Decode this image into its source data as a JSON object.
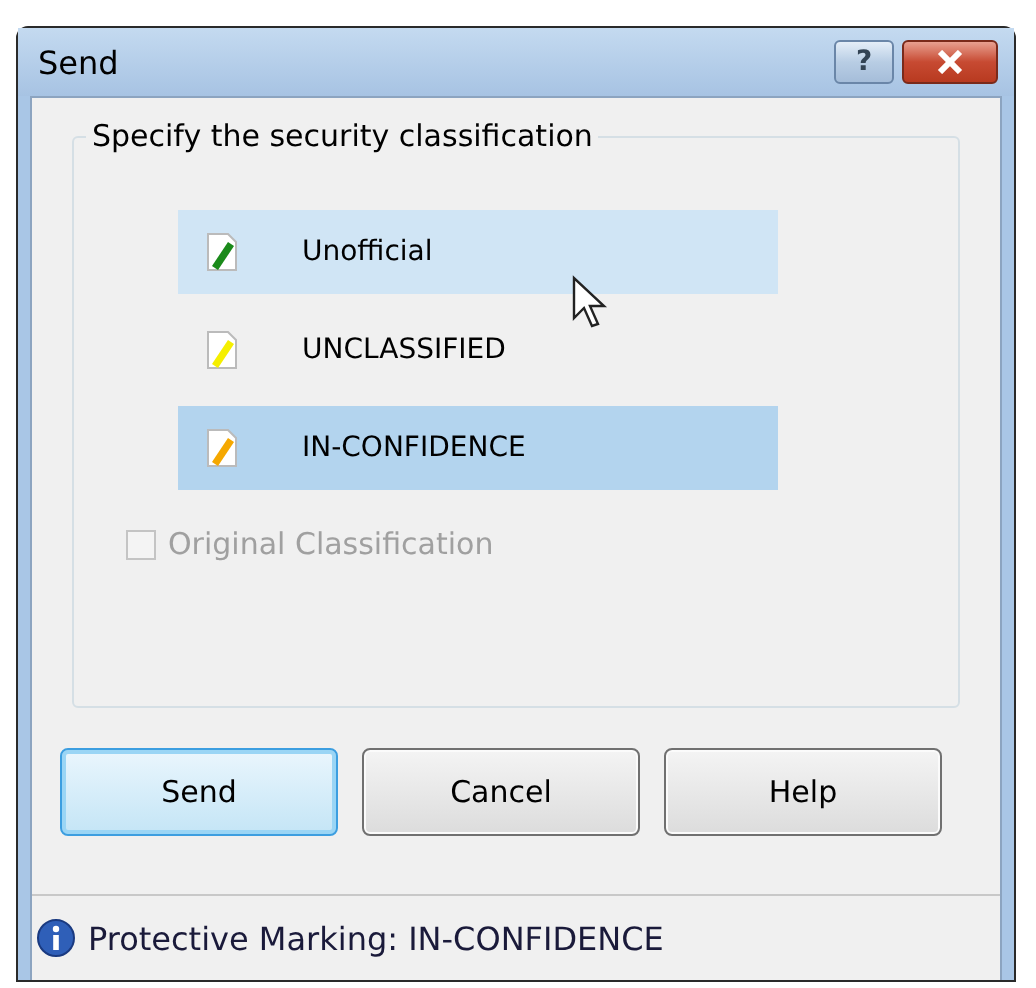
{
  "window": {
    "title": "Send",
    "title_buttons": [
      {
        "kind": "help",
        "label": "?"
      },
      {
        "kind": "close"
      }
    ]
  },
  "group": {
    "label": "Specify the security classification",
    "items": [
      {
        "label": "Unofficial",
        "color": "#1a8a1a",
        "hovered": true,
        "selected": false
      },
      {
        "label": "UNCLASSIFIED",
        "color": "#f5ef00",
        "hovered": false,
        "selected": false
      },
      {
        "label": "IN-CONFIDENCE",
        "color": "#f5a800",
        "hovered": false,
        "selected": true
      }
    ],
    "checkbox": {
      "label": "Original Classification",
      "checked": false,
      "disabled": true
    }
  },
  "buttons": [
    {
      "label": "Send",
      "default": true
    },
    {
      "label": "Cancel",
      "default": false
    },
    {
      "label": "Help",
      "default": false
    }
  ],
  "status_bar": {
    "text": "Protective Marking: IN-CONFIDENCE"
  }
}
